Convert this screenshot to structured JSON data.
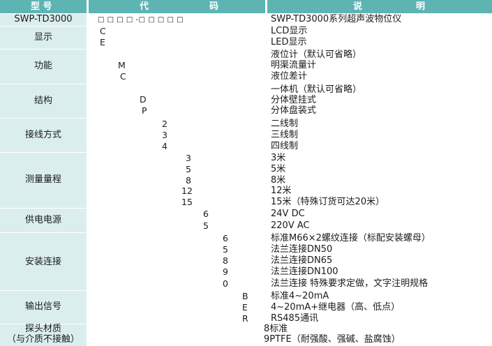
{
  "header": {
    "model_label": "型  号",
    "code_label_1": "代",
    "code_label_2": "码",
    "desc_label_1": "说",
    "desc_label_2": "明"
  },
  "model_row": {
    "model": "SWP-TD3000",
    "placeholders": "□    □    □    □   -□    □    □    □    □",
    "description": "SWP-TD3000系列超声波物位仪"
  },
  "groups": [
    {
      "name": "显示",
      "codes": [
        "C",
        "E"
      ],
      "descriptions": [
        "LCD显示",
        "LED显示"
      ]
    },
    {
      "name": "功能",
      "codes": [
        "",
        "M",
        "C"
      ],
      "descriptions": [
        "液位计（默认可省略）",
        "明渠流量计",
        "液位差计"
      ]
    },
    {
      "name": "结构",
      "codes": [
        "",
        "D",
        "P"
      ],
      "descriptions": [
        "一体机（默认可省略）",
        "分体壁挂式",
        "分体盘装式"
      ]
    },
    {
      "name": "接线方式",
      "codes": [
        "2",
        "3",
        "4"
      ],
      "descriptions": [
        "二线制",
        "三线制",
        "四线制"
      ]
    },
    {
      "name": "测量量程",
      "codes": [
        "3",
        "5",
        "8",
        "12",
        "15"
      ],
      "descriptions": [
        "3米",
        "5米",
        "8米",
        "12米",
        "15米（特殊订货可达20米）"
      ]
    },
    {
      "name": "供电电源",
      "codes": [
        "6",
        "5"
      ],
      "descriptions": [
        "24V DC",
        "220V AC"
      ]
    },
    {
      "name": "安装连接",
      "codes": [
        "6",
        "5",
        "8",
        "9",
        "0"
      ],
      "descriptions": [
        "标准M66×2螺纹连接（标配安装螺母）",
        "法兰连接DN50",
        "法兰连接DN65",
        "法兰连接DN100",
        "法兰连接 特殊要求定做，文字注明规格"
      ]
    },
    {
      "name": "输出信号",
      "codes": [
        "B",
        "E",
        "R"
      ],
      "descriptions": [
        "标准4~20mA",
        "4~20mA+继电器（高、低点）",
        "RS485通讯"
      ]
    },
    {
      "name_lines": [
        "探头材质",
        "（与介质不接触）"
      ],
      "codes": [
        "",
        ""
      ],
      "descriptions": [
        "8标准",
        "9PTFE（耐强酸、强碱、盐腐蚀）"
      ]
    }
  ],
  "colors": {
    "header": "#5eb3b3",
    "label_column": "#dbeeee",
    "header_text": "#ffffff"
  }
}
